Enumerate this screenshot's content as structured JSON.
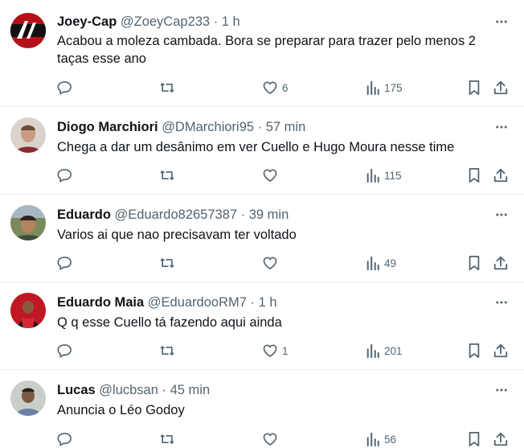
{
  "colors": {
    "text": "#0f1419",
    "secondary": "#536471",
    "border": "#eff3f4"
  },
  "icons": {
    "more": "more-icon",
    "reply": "reply-icon",
    "retweet": "retweet-icon",
    "like": "heart-icon",
    "views": "views-icon",
    "bookmark": "bookmark-icon",
    "share": "share-icon"
  },
  "replies": [
    {
      "name": "Joey-Cap",
      "handle": "@ZoeyCap233",
      "separator": "·",
      "time": "1 h",
      "text_lines": [
        "Acabou a moleza cambada. Bora se preparar para trazer pelo menos 2",
        "taças esse ano"
      ],
      "likes": "6",
      "views": "175"
    },
    {
      "name": "Diogo Marchiori",
      "handle": "@DMarchiori95",
      "separator": "·",
      "time": "57 min",
      "text_lines": [
        "Chega a dar um desânimo em ver Cuello e Hugo Moura nesse time"
      ],
      "likes": "",
      "views": "115"
    },
    {
      "name": "Eduardo",
      "handle": "@Eduardo82657387",
      "separator": "·",
      "time": "39 min",
      "text_lines": [
        "Varios ai que nao precisavam ter voltado"
      ],
      "likes": "",
      "views": "49"
    },
    {
      "name": "Eduardo Maia",
      "handle": "@EduardooRM7",
      "separator": "·",
      "time": "1 h",
      "text_lines": [
        "Q q esse Cuello tá fazendo aqui ainda"
      ],
      "likes": "1",
      "views": "201"
    },
    {
      "name": "Lucas",
      "handle": "@lucbsan",
      "separator": "·",
      "time": "45 min",
      "text_lines": [
        "Anuncia o Léo Godoy"
      ],
      "likes": "",
      "views": "56"
    }
  ]
}
